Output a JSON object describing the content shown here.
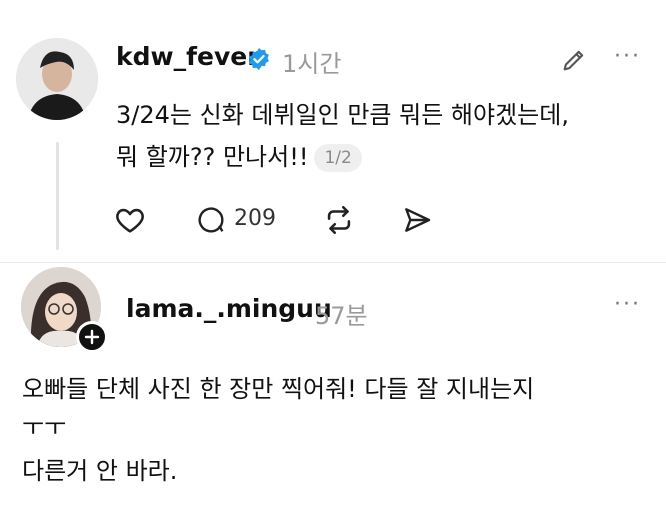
{
  "post1": {
    "username": "kdw_fever",
    "verified": true,
    "time": "1시간",
    "line1": "3/24는 신화 데뷔일인 만큼 뭐든 해야겠는데,",
    "line2": "뭐 할까?? 만나서!!",
    "page_indicator": "1/2",
    "reply_count": "209",
    "icons": [
      "edit-icon",
      "more-icon",
      "heart-icon",
      "comment-icon",
      "repost-icon",
      "share-icon"
    ]
  },
  "post2": {
    "username": "lama._.minguu",
    "time": "57분",
    "line1": "오빠들 단체 사진 한 장만 찍어줘! 다들 잘 지내는지",
    "line2": "ㅜㅜ",
    "line3": "다른거 안 바라.",
    "icons": [
      "more-icon",
      "follow-plus-icon"
    ]
  },
  "colors": {
    "verified_blue": "#1d9bf0",
    "muted": "#9a9a9a"
  }
}
